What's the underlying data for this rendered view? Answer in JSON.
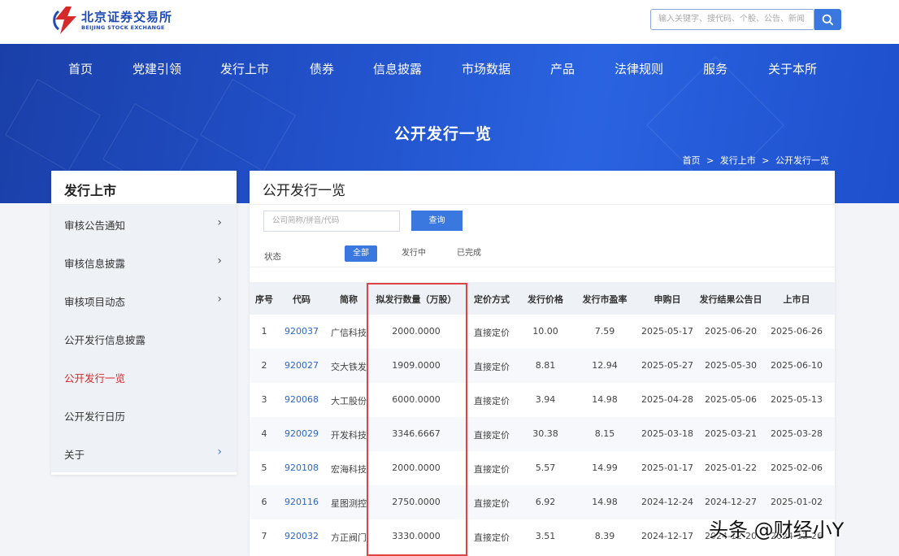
{
  "header": {
    "logo_cn": "北京证券交易所",
    "logo_en": "BEIJING STOCK EXCHANGE",
    "search_placeholder": "输入关键字、搜代码、个股、公告、新闻",
    "search_icon": "search-icon"
  },
  "nav": [
    "首页",
    "党建引领",
    "发行上市",
    "债券",
    "信息披露",
    "市场数据",
    "产品",
    "法律规则",
    "服务",
    "关于本所"
  ],
  "banner": {
    "title": "公开发行一览",
    "breadcrumb": [
      "首页",
      "发行上市",
      "公开发行一览"
    ],
    "separator": ">"
  },
  "sidebar": {
    "title": "发行上市",
    "items": [
      {
        "label": "审核公告通知",
        "arrow": "›"
      },
      {
        "label": "审核信息披露",
        "arrow": "›"
      },
      {
        "label": "审核项目动态",
        "arrow": "›"
      },
      {
        "label": "公开发行信息披露",
        "arrow": ""
      },
      {
        "label": "公开发行一览",
        "arrow": ""
      },
      {
        "label": "公开发行日历",
        "arrow": ""
      },
      {
        "label": "关于",
        "arrow": "›"
      }
    ],
    "active_color": "#d62a2a"
  },
  "panel": {
    "title": "公开发行一览",
    "query_placeholder": "公司简称/拼音/代码",
    "query_button": "查询",
    "status_label": "状态",
    "filters": [
      "全部",
      "发行中",
      "已完成"
    ]
  },
  "table": {
    "columns": [
      "序号",
      "代码",
      "简称",
      "拟发行数量（万股）",
      "定价方式",
      "发行价格",
      "发行市盈率",
      "申购日",
      "发行结果公告日",
      "上市日"
    ],
    "rows": [
      [
        "1",
        "920037",
        "广信科技",
        "2000.0000",
        "直接定价",
        "10.00",
        "7.59",
        "2025-05-17",
        "2025-06-20",
        "2025-06-26"
      ],
      [
        "2",
        "920027",
        "交大铁发",
        "1909.0000",
        "直接定价",
        "8.81",
        "12.94",
        "2025-05-27",
        "2025-05-30",
        "2025-06-10"
      ],
      [
        "3",
        "920068",
        "大工股份",
        "6000.0000",
        "直接定价",
        "3.94",
        "14.98",
        "2025-04-28",
        "2025-05-06",
        "2025-05-13"
      ],
      [
        "4",
        "920029",
        "开发科技",
        "3346.6667",
        "直接定价",
        "30.38",
        "8.15",
        "2025-03-18",
        "2025-03-21",
        "2025-03-28"
      ],
      [
        "5",
        "920108",
        "宏海科技",
        "2000.0000",
        "直接定价",
        "5.57",
        "14.99",
        "2025-01-17",
        "2025-01-22",
        "2025-02-06"
      ],
      [
        "6",
        "920116",
        "星图测控",
        "2750.0000",
        "直接定价",
        "6.92",
        "14.98",
        "2024-12-24",
        "2024-12-27",
        "2025-01-02"
      ],
      [
        "7",
        "920032",
        "方正阀门",
        "3330.0000",
        "直接定价",
        "3.51",
        "8.39",
        "2024-12-17",
        "2024-12-20",
        "2024-12-26"
      ]
    ]
  },
  "colors": {
    "brand_blue": "#1f4bb8",
    "accent_blue": "#3a78e0",
    "highlight_red": "#e04343"
  },
  "watermark": "头条 @财经小Y"
}
